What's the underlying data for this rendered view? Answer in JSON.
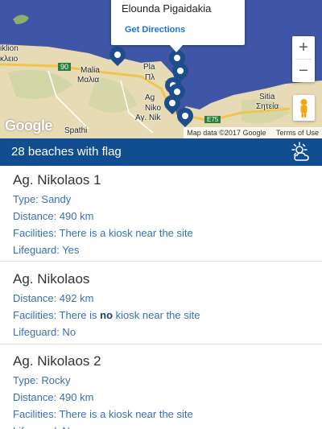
{
  "map": {
    "info_window": {
      "title": "Elounda Pigaidakia",
      "link": "Get Directions"
    },
    "labels": {
      "iraklion_en": "iklion",
      "iraklion_gr": "κλειο",
      "road_90": "90",
      "malia_en": "Malia",
      "malia_gr": "Μαλια",
      "pla": "Pla",
      "pl": "Πλ",
      "ag": "Ag",
      "niko": "Niko",
      "ay_nik": "Αγ. Nik",
      "sitia_en": "Sitia",
      "sitia_gr": "Σητεία",
      "spathi": "Spathi",
      "road_e75": "E75"
    },
    "zoom_in": "+",
    "zoom_out": "−",
    "logo": "Google",
    "attribution": {
      "map_data": "Map data ©2017 Google",
      "terms": "Terms of Use"
    },
    "colors": {
      "sea": "#3f56a6",
      "land": "#e8dcb7",
      "pin": "#1d4d8a"
    }
  },
  "header": {
    "title": "28 beaches with flag",
    "icon": "weather-sun-cloud-icon"
  },
  "beaches": [
    {
      "name": "Ag. Nikolaos 1",
      "type": "Type: Sandy",
      "distance": "Distance: 490 km",
      "facilities": "Facilities: There is a kiosk near the site",
      "lifeguard": "Lifeguard: Yes"
    },
    {
      "name": "Ag. Nikolaos",
      "distance": "Distance: 492 km",
      "facilities_pre": "Facilities: There is ",
      "facilities_bold": "no",
      "facilities_post": " kiosk near the site",
      "lifeguard": "Lifeguard: No"
    },
    {
      "name": "Ag. Nikolaos 2",
      "type": "Type: Rocky",
      "distance": "Distance: 490 km",
      "facilities": "Facilities: There is a kiosk near the site",
      "lifeguard": "Lifeguard: No"
    }
  ]
}
